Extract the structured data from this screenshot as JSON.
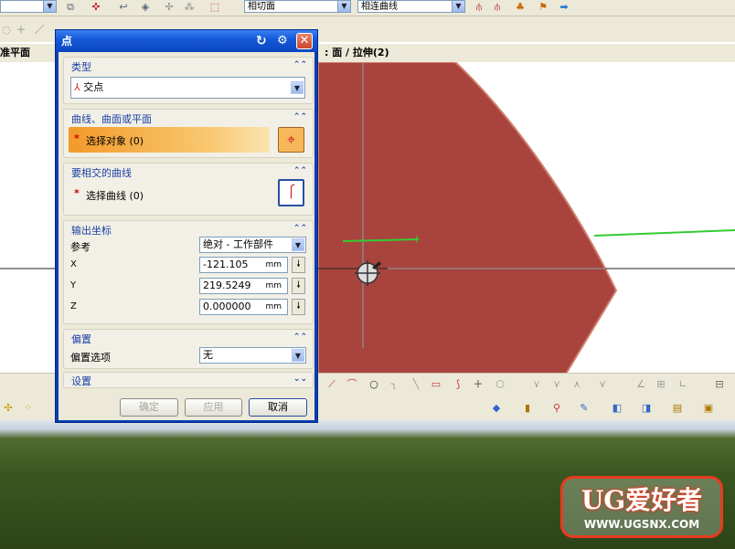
{
  "toolbar_top": {
    "selection_filter_1": "相切面",
    "selection_filter_2": "相连曲线"
  },
  "view": {
    "title_left": "准平面",
    "title_right": ": 面 / 拉伸(2)"
  },
  "dialog": {
    "title": "点",
    "sections": {
      "type": {
        "header": "类型",
        "value": "交点"
      },
      "curve_surface": {
        "header": "曲线、曲面或平面",
        "select_label": "选择对象 (0)"
      },
      "intersect_curve": {
        "header": "要相交的曲线",
        "select_label": "选择曲线 (0)"
      },
      "output": {
        "header": "输出坐标",
        "reference_label": "参考",
        "reference_value": "绝对 - 工作部件",
        "x_label": "X",
        "x_value": "-121.105",
        "y_label": "Y",
        "y_value": "219.5249",
        "z_label": "Z",
        "z_value": "0.000000",
        "unit": "mm"
      },
      "offset": {
        "header": "偏置",
        "option_label": "偏置选项",
        "option_value": "无"
      },
      "settings": {
        "header": "设置"
      }
    },
    "buttons": {
      "ok": "确定",
      "apply": "应用",
      "cancel": "取消"
    }
  },
  "watermark": {
    "logo_text": "UG爱好者",
    "url": "WWW.UGSNX.COM"
  },
  "colors": {
    "face": "#a8443d",
    "selection_bar": "#f0a030",
    "accent_blue": "#1a3fa6",
    "green_curve": "#33cc33"
  }
}
